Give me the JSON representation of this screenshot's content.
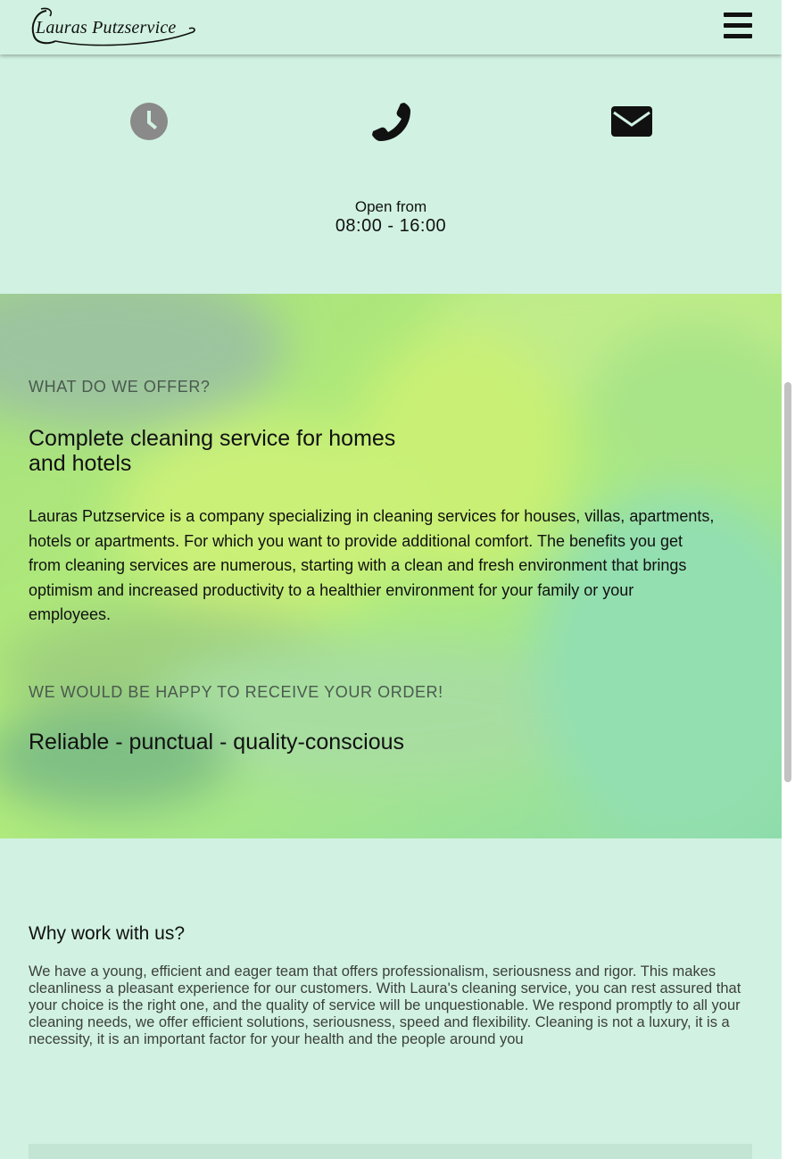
{
  "header": {
    "logo_text": "Lauras Putzservice",
    "menu_icon": "hamburger-menu-icon"
  },
  "contact": {
    "icons": [
      "clock-icon",
      "phone-icon",
      "envelope-icon"
    ],
    "hours_label": "Open from",
    "hours_time": "08:00 - 16:00"
  },
  "hero": {
    "eyebrow": "WHAT DO WE OFFER?",
    "title": "Complete cleaning service for homes and hotels",
    "body": "Lauras Putzservice is a company specializing in cleaning services for houses, villas, apartments, hotels or apartments. For which you want to provide additional comfort. The benefits you get from cleaning services are numerous, starting with a clean and fresh environment that brings optimism and increased productivity to a healthier environment for your family or your employees.",
    "order_eyebrow": "WE WOULD BE HAPPY TO RECEIVE YOUR ORDER!",
    "tagline": "Reliable - punctual - quality-conscious"
  },
  "why": {
    "title": "Why work with us?",
    "body": "We have a young, efficient and eager team that offers professionalism, seriousness and rigor. This makes cleanliness a pleasant experience for our customers. With Laura's cleaning service, you can rest assured that your choice is the right one, and the quality of service will be unquestionable. We respond promptly to all your cleaning needs, we offer efficient solutions, seriousness, speed and flexibility. Cleaning is not a luxury, it is a necessity, it is an important factor for your health and the people around you"
  },
  "colors": {
    "page_bg": "#d1f2e2",
    "hero_green": "#8fd99a",
    "eyebrow_text": "#4a5a4e",
    "icon_grey": "#8a8a8a",
    "icon_dark": "#111111"
  }
}
